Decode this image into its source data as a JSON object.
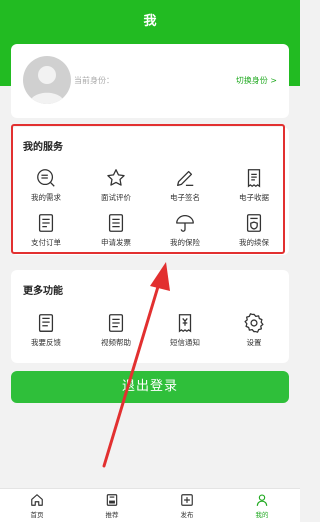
{
  "header": {
    "title": "我"
  },
  "profile": {
    "identity_label": "当前身份：",
    "switch_label": "切换身份 >"
  },
  "services": {
    "title": "我的服务",
    "items": [
      {
        "label": "我的需求",
        "icon": "search-list-icon"
      },
      {
        "label": "面试评价",
        "icon": "star-icon"
      },
      {
        "label": "电子签名",
        "icon": "pen-icon"
      },
      {
        "label": "电子收据",
        "icon": "receipt-icon"
      },
      {
        "label": "支付订单",
        "icon": "order-list-icon"
      },
      {
        "label": "申请发票",
        "icon": "invoice-icon"
      },
      {
        "label": "我的保险",
        "icon": "umbrella-icon"
      },
      {
        "label": "我的续保",
        "icon": "renew-insurance-icon"
      }
    ]
  },
  "more": {
    "title": "更多功能",
    "items": [
      {
        "label": "我要反馈",
        "icon": "feedback-icon"
      },
      {
        "label": "视频帮助",
        "icon": "video-help-icon"
      },
      {
        "label": "短信通知",
        "icon": "sms-notice-icon"
      },
      {
        "label": "设置",
        "icon": "gear-icon"
      }
    ]
  },
  "logout": {
    "label": "退出登录"
  },
  "tabbar": {
    "items": [
      {
        "label": "首页",
        "icon": "home-icon"
      },
      {
        "label": "推荐",
        "icon": "recommend-icon"
      },
      {
        "label": "发布",
        "icon": "publish-icon"
      },
      {
        "label": "我的",
        "icon": "user-icon",
        "active": true
      }
    ]
  },
  "colors": {
    "brand": "#22bb22",
    "highlight": "#e23030",
    "logout": "#2fbf3a"
  }
}
